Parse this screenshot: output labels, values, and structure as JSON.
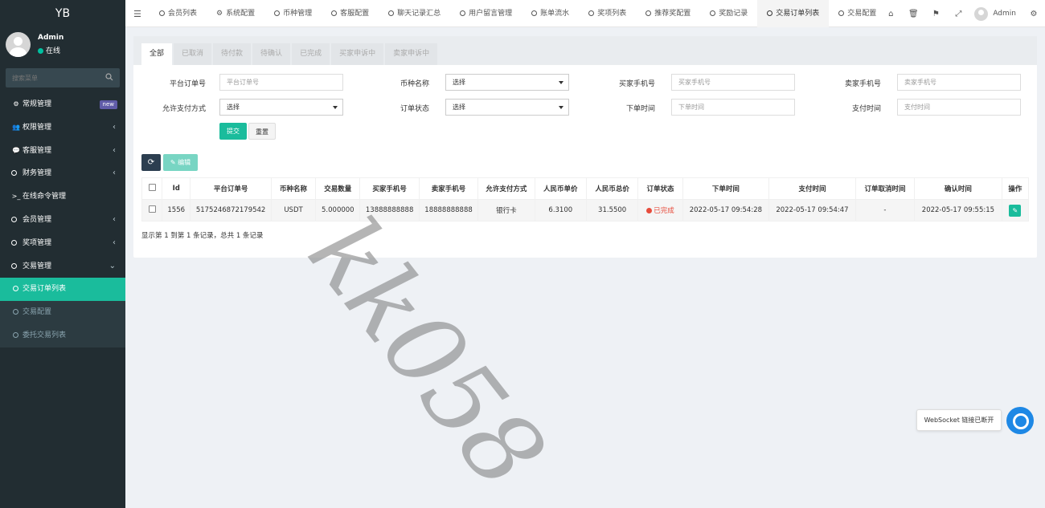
{
  "sidebar": {
    "logo": "YB",
    "user": {
      "name": "Admin",
      "status": "在线"
    },
    "search_placeholder": "搜索菜单",
    "items": [
      {
        "label": "常规管理",
        "badge": "new",
        "icon": "cogs-icon"
      },
      {
        "label": "权限管理",
        "icon": "users-icon"
      },
      {
        "label": "客服管理",
        "icon": "comment-icon"
      },
      {
        "label": "财务管理",
        "icon": "circle-icon"
      },
      {
        "label": "在线命令管理",
        "icon": "terminal-icon"
      },
      {
        "label": "会员管理",
        "icon": "circle-icon"
      },
      {
        "label": "奖项管理",
        "icon": "circle-icon"
      },
      {
        "label": "交易管理",
        "icon": "circle-icon"
      }
    ],
    "sub_items": [
      {
        "label": "交易订单列表",
        "active": true
      },
      {
        "label": "交易配置"
      },
      {
        "label": "委托交易列表"
      }
    ]
  },
  "topbar": {
    "tabs": [
      "会员列表",
      "系统配置",
      "币种管理",
      "客服配置",
      "聊天记录汇总",
      "用户留言管理",
      "账单流水",
      "奖项列表",
      "推荐奖配置",
      "奖励记录",
      "交易订单列表",
      "交易配置"
    ],
    "active_tab": "交易订单列表",
    "user_name": "Admin"
  },
  "filter_tabs": [
    "全部",
    "已取消",
    "待付款",
    "待确认",
    "已完成",
    "买家申诉中",
    "卖家申诉中"
  ],
  "form": {
    "platform_order_label": "平台订单号",
    "platform_order_placeholder": "平台订单号",
    "currency_label": "币种名称",
    "currency_value": "选择",
    "buyer_phone_label": "买家手机号",
    "buyer_phone_placeholder": "买家手机号",
    "seller_phone_label": "卖家手机号",
    "seller_phone_placeholder": "卖家手机号",
    "pay_method_label": "允许支付方式",
    "pay_method_value": "选择",
    "order_status_label": "订单状态",
    "order_status_value": "选择",
    "order_time_label": "下单时间",
    "order_time_placeholder": "下单时间",
    "pay_time_label": "支付时间",
    "pay_time_placeholder": "支付时间",
    "submit": "提交",
    "reset": "重置"
  },
  "toolbar": {
    "edit": "编辑"
  },
  "table": {
    "headers": [
      "Id",
      "平台订单号",
      "币种名称",
      "交易数量",
      "买家手机号",
      "卖家手机号",
      "允许支付方式",
      "人民币单价",
      "人民币总价",
      "订单状态",
      "下单时间",
      "支付时间",
      "订单取消时间",
      "确认时间",
      "操作"
    ],
    "rows": [
      {
        "id": "1556",
        "order_no": "5175246872179542",
        "currency": "USDT",
        "amount": "5.000000",
        "buyer_phone": "13888888888",
        "seller_phone": "18888888888",
        "pay_method": "银行卡",
        "unit_price": "6.3100",
        "total_price": "31.5500",
        "status": "已完成",
        "order_time": "2022-05-17 09:54:28",
        "pay_time": "2022-05-17 09:54:47",
        "cancel_time": "-",
        "confirm_time": "2022-05-17 09:55:15"
      }
    ]
  },
  "pager": "显示第 1 到第 1 条记录，总共 1 条记录",
  "watermark": "kk058",
  "websocket_notice": "WebSocket 链接已断开",
  "colors": {
    "accent": "#1abc9c",
    "sidebar_bg": "#222d32",
    "status_done": "#e74c3c"
  }
}
